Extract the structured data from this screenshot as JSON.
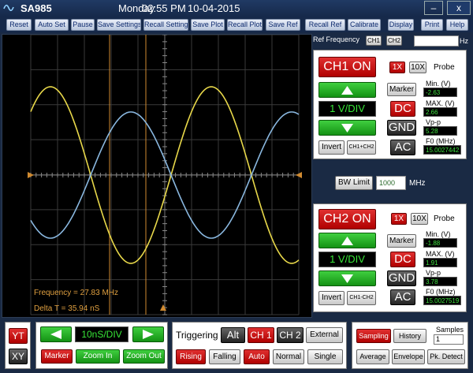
{
  "app": {
    "title": "SA985",
    "day": "Monday",
    "time": "02:55 PM",
    "date": "10-04-2015"
  },
  "window": {
    "minimize": "–",
    "restore": "□",
    "close": "x"
  },
  "toolbar": [
    "Reset",
    "Auto Set",
    "Pause",
    "Save Settings",
    "Recall Settings",
    "Save Plot",
    "Recall Plot",
    "Save Ref",
    "Recall Ref",
    "Calibrate",
    "Display",
    "Print",
    "Help"
  ],
  "scope": {
    "frequency_readout": "Frequency = 27.83 MHz",
    "delta_readout": "Delta T = 35.94 nS",
    "colors": {
      "ch1": "#e8d84a",
      "ch2": "#8ab8e0",
      "cursor": "#d08a30",
      "grid": "#3a3a3a"
    }
  },
  "ref_frequency": {
    "label": "Ref Frequency",
    "ch1": "CH1",
    "ch2": "CH2",
    "value": "",
    "unit": "Hz"
  },
  "ch1": {
    "on_label": "CH1 ON",
    "probe_1x": "1X",
    "probe_10x": "10X",
    "probe_label": "Probe",
    "vdiv": "1 V/DIV",
    "marker": "Marker",
    "dc": "DC",
    "gnd": "GND",
    "ac": "AC",
    "invert": "Invert",
    "math": "CH1+CH2",
    "min_label": "Min. (V)",
    "min_value": "-2.63",
    "max_label": "MAX. (V)",
    "max_value": "2.66",
    "vpp_label": "Vp-p",
    "vpp_value": "5.28",
    "f0_label": "F0 (MHz)",
    "f0_value": "15.0027442"
  },
  "bw": {
    "button": "BW Limit",
    "value": "1000",
    "unit": "MHz"
  },
  "ch2": {
    "on_label": "CH2 ON",
    "probe_1x": "1X",
    "probe_10x": "10X",
    "probe_label": "Probe",
    "vdiv": "1 V/DIV",
    "marker": "Marker",
    "dc": "DC",
    "gnd": "GND",
    "ac": "AC",
    "invert": "Invert",
    "math": "CH1-CH2",
    "min_label": "Min. (V)",
    "min_value": "-1.88",
    "max_label": "MAX. (V)",
    "max_value": "1.91",
    "vpp_label": "Vp-p",
    "vpp_value": "3.78",
    "f0_label": "F0 (MHz)",
    "f0_value": "15.0027519"
  },
  "bottom": {
    "yt": "YT",
    "xy": "XY",
    "timebase": "10nS/DIV",
    "marker": "Marker",
    "zoom_in": "Zoom In",
    "zoom_out": "Zoom Out",
    "triggering": "Triggering",
    "alt": "Alt",
    "ch1": "CH 1",
    "ch2": "CH 2",
    "external": "External",
    "rising": "Rising",
    "falling": "Falling",
    "auto": "Auto",
    "normal": "Normal",
    "single": "Single",
    "sampling": "Sampling",
    "history": "History",
    "samples_label": "Samples",
    "samples_value": "1",
    "average": "Average",
    "envelope": "Envelope",
    "pk_detect": "Pk. Detect"
  }
}
